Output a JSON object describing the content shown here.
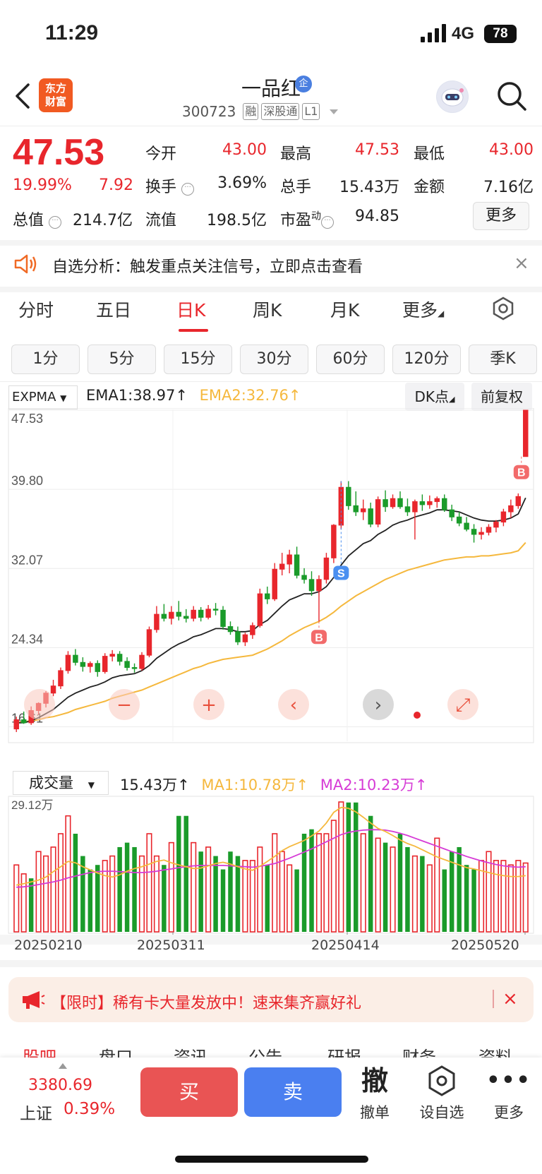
{
  "status": {
    "time": "11:29",
    "network": "4G",
    "battery": "78"
  },
  "header": {
    "logo_line1": "东方",
    "logo_line2": "财富",
    "stock_name": "一品红",
    "qi_badge": "企",
    "code": "300723",
    "tags": [
      "融",
      "深股通",
      "L1"
    ]
  },
  "quote": {
    "price": "47.53",
    "change_pct": "19.99%",
    "change": "7.92",
    "open_label": "今开",
    "open": "43.00",
    "high_label": "最高",
    "high": "47.53",
    "low_label": "最低",
    "low": "43.00",
    "turnover_label": "换手",
    "turnover": "3.69%",
    "volume_label": "总手",
    "volume": "15.43万",
    "amount_label": "金额",
    "amount": "7.16亿",
    "mktcap_label": "总值",
    "mktcap": "214.7亿",
    "float_label": "流值",
    "float": "198.5亿",
    "pe_label": "市盈",
    "pe_sup": "动",
    "pe": "94.85",
    "more": "更多"
  },
  "alert": {
    "text": "自选分析：触发重点关注信号，立即点击查看",
    "close": "×"
  },
  "tabs": [
    "分时",
    "五日",
    "日K",
    "周K",
    "月K",
    "更多"
  ],
  "active_tab": "日K",
  "periods": [
    "1分",
    "5分",
    "15分",
    "30分",
    "60分",
    "120分",
    "季K"
  ],
  "indicator": {
    "select": "EXPMA",
    "ema1": "EMA1:38.97",
    "ema2": "EMA2:32.76",
    "dk": "DK点",
    "adjust": "前复权",
    "ema1_color": "#222222",
    "ema2_color": "#f5b83d"
  },
  "price_axis": [
    "47.53",
    "39.80",
    "32.07",
    "24.34",
    "16.61"
  ],
  "volume_panel": {
    "select": "成交量",
    "value": "15.43万",
    "ma1": "MA1:10.78万",
    "ma2": "MA2:10.23万",
    "max": "29.12万",
    "ma1_color": "#f5b83d",
    "ma2_color": "#d63bd6"
  },
  "dates": [
    "20250210",
    "20250311",
    "20250414",
    "20250520"
  ],
  "chart_data": {
    "type": "candlestick",
    "ylim": [
      16.61,
      47.53
    ],
    "candles_ohlc": [
      [
        16.4,
        17.6,
        16.1,
        17.3
      ],
      [
        17.3,
        18.1,
        16.9,
        17.0
      ],
      [
        17.0,
        18.6,
        16.8,
        18.2
      ],
      [
        18.2,
        19.0,
        17.8,
        18.9
      ],
      [
        18.9,
        20.1,
        18.5,
        19.9
      ],
      [
        19.9,
        21.2,
        19.6,
        20.6
      ],
      [
        20.6,
        22.4,
        20.3,
        22.1
      ],
      [
        22.1,
        24.0,
        21.8,
        23.6
      ],
      [
        23.6,
        24.2,
        22.6,
        22.9
      ],
      [
        22.9,
        23.4,
        22.0,
        22.5
      ],
      [
        22.5,
        23.0,
        21.9,
        22.8
      ],
      [
        22.8,
        23.1,
        21.5,
        22.0
      ],
      [
        22.0,
        23.8,
        21.8,
        23.5
      ],
      [
        23.5,
        24.1,
        23.0,
        23.7
      ],
      [
        23.7,
        24.0,
        22.6,
        23.0
      ],
      [
        23.0,
        23.4,
        22.1,
        22.4
      ],
      [
        22.4,
        22.8,
        21.9,
        22.3
      ],
      [
        22.3,
        23.9,
        22.1,
        23.6
      ],
      [
        23.6,
        26.4,
        23.4,
        26.1
      ],
      [
        26.1,
        28.4,
        25.8,
        27.6
      ],
      [
        27.6,
        28.6,
        26.9,
        27.2
      ],
      [
        27.2,
        28.4,
        26.6,
        27.8
      ],
      [
        27.8,
        28.9,
        27.0,
        27.4
      ],
      [
        27.4,
        28.1,
        26.8,
        27.2
      ],
      [
        27.2,
        28.4,
        26.9,
        28.0
      ],
      [
        28.0,
        28.3,
        26.9,
        27.3
      ],
      [
        27.3,
        28.5,
        27.1,
        28.1
      ],
      [
        28.1,
        28.7,
        27.5,
        28.0
      ],
      [
        28.0,
        28.4,
        26.1,
        26.4
      ],
      [
        26.4,
        26.9,
        25.6,
        25.9
      ],
      [
        25.9,
        26.4,
        24.6,
        24.9
      ],
      [
        24.9,
        25.8,
        24.5,
        25.6
      ],
      [
        25.6,
        26.8,
        25.2,
        26.5
      ],
      [
        26.5,
        30.1,
        26.3,
        29.6
      ],
      [
        29.6,
        30.3,
        28.6,
        29.1
      ],
      [
        29.1,
        32.6,
        28.9,
        32.0
      ],
      [
        32.0,
        33.6,
        31.4,
        32.5
      ],
      [
        32.5,
        33.9,
        31.6,
        33.4
      ],
      [
        33.4,
        34.2,
        31.1,
        31.4
      ],
      [
        31.4,
        32.1,
        30.6,
        31.0
      ],
      [
        31.0,
        31.8,
        29.4,
        29.9
      ],
      [
        29.9,
        31.4,
        26.9,
        31.0
      ],
      [
        31.0,
        33.6,
        30.6,
        33.1
      ],
      [
        33.1,
        36.4,
        32.6,
        36.3
      ],
      [
        36.3,
        40.6,
        35.9,
        40.0
      ],
      [
        40.0,
        40.6,
        37.8,
        38.2
      ],
      [
        38.2,
        39.6,
        37.2,
        37.6
      ],
      [
        37.6,
        38.8,
        36.8,
        37.9
      ],
      [
        37.9,
        38.5,
        36.1,
        36.4
      ],
      [
        36.4,
        39.1,
        36.1,
        38.8
      ],
      [
        38.8,
        39.7,
        37.6,
        38.1
      ],
      [
        38.1,
        39.3,
        37.9,
        38.9
      ],
      [
        38.9,
        39.6,
        37.9,
        38.1
      ],
      [
        38.1,
        38.9,
        37.2,
        37.6
      ],
      [
        37.6,
        38.8,
        34.9,
        38.6
      ],
      [
        38.6,
        39.3,
        37.7,
        38.3
      ],
      [
        38.3,
        39.2,
        37.9,
        38.6
      ],
      [
        38.6,
        39.1,
        38.0,
        38.9
      ],
      [
        38.9,
        39.3,
        37.6,
        37.8
      ],
      [
        37.8,
        38.3,
        36.7,
        37.1
      ],
      [
        37.1,
        37.6,
        36.2,
        36.5
      ],
      [
        36.5,
        37.1,
        35.7,
        35.9
      ],
      [
        35.9,
        36.4,
        34.6,
        35.4
      ],
      [
        35.4,
        36.1,
        34.9,
        35.6
      ],
      [
        35.6,
        36.4,
        35.3,
        36.1
      ],
      [
        36.1,
        36.8,
        35.6,
        36.6
      ],
      [
        36.6,
        37.9,
        36.2,
        37.6
      ],
      [
        37.6,
        38.8,
        37.0,
        38.2
      ],
      [
        38.2,
        39.4,
        37.9,
        39.1
      ],
      [
        43.0,
        47.53,
        43.0,
        47.53
      ]
    ],
    "ema1": [
      17.0,
      17.0,
      17.2,
      17.5,
      17.9,
      18.3,
      18.9,
      19.5,
      19.9,
      20.2,
      20.5,
      20.7,
      21.0,
      21.4,
      21.6,
      21.7,
      21.8,
      22.1,
      22.6,
      23.3,
      23.8,
      24.3,
      24.7,
      25.0,
      25.4,
      25.6,
      25.9,
      26.2,
      26.2,
      26.1,
      25.9,
      25.9,
      26.0,
      26.6,
      27.0,
      27.7,
      28.4,
      29.0,
      29.3,
      29.6,
      29.6,
      29.8,
      30.3,
      31.2,
      32.4,
      33.3,
      33.9,
      34.5,
      34.8,
      35.4,
      35.8,
      36.3,
      36.6,
      36.8,
      37.1,
      37.3,
      37.5,
      37.8,
      37.8,
      37.7,
      37.6,
      37.3,
      37.0,
      36.8,
      36.7,
      36.7,
      36.8,
      37.0,
      37.4,
      38.97
    ],
    "ema2": [
      17.0,
      17.1,
      17.2,
      17.3,
      17.5,
      17.6,
      17.8,
      18.0,
      18.3,
      18.5,
      18.7,
      18.9,
      19.1,
      19.4,
      19.6,
      19.8,
      20.0,
      20.2,
      20.5,
      20.8,
      21.1,
      21.4,
      21.7,
      22.0,
      22.3,
      22.5,
      22.8,
      23.0,
      23.2,
      23.3,
      23.4,
      23.5,
      23.6,
      23.9,
      24.2,
      24.6,
      25.0,
      25.5,
      25.9,
      26.3,
      26.6,
      26.9,
      27.3,
      27.8,
      28.4,
      28.9,
      29.4,
      29.8,
      30.2,
      30.6,
      31.0,
      31.3,
      31.6,
      31.9,
      32.1,
      32.3,
      32.5,
      32.7,
      32.9,
      33.0,
      33.1,
      33.2,
      33.2,
      33.3,
      33.3,
      33.4,
      33.5,
      33.6,
      33.8,
      34.6
    ],
    "volume_wan": [
      15,
      13,
      12,
      18,
      17,
      19,
      22,
      26,
      22,
      17,
      14,
      15,
      16,
      17,
      19,
      20,
      19,
      17,
      22,
      17,
      15,
      20,
      26,
      26,
      20,
      18,
      19,
      17,
      14,
      18,
      17,
      16,
      16,
      19,
      15,
      22,
      18,
      15,
      14,
      22,
      23,
      22,
      22,
      25,
      29.12,
      29,
      29,
      22,
      26,
      21,
      20,
      19,
      22,
      19,
      17,
      17,
      15,
      21,
      14,
      18,
      19,
      15,
      14,
      16,
      18,
      16,
      16,
      15,
      16,
      15.43
    ],
    "volume_up": [
      true,
      true,
      false,
      true,
      true,
      true,
      true,
      true,
      false,
      false,
      false,
      false,
      true,
      true,
      false,
      false,
      false,
      true,
      true,
      true,
      false,
      true,
      false,
      false,
      true,
      false,
      true,
      false,
      false,
      false,
      false,
      true,
      true,
      true,
      false,
      true,
      true,
      true,
      false,
      false,
      false,
      true,
      true,
      true,
      true,
      false,
      false,
      true,
      false,
      true,
      false,
      true,
      false,
      false,
      true,
      false,
      true,
      true,
      false,
      false,
      false,
      false,
      false,
      true,
      true,
      true,
      true,
      true,
      true,
      true
    ],
    "ma1": [
      10.5,
      10.8,
      11.2,
      11.6,
      12.3,
      13.5,
      14.6,
      15.8,
      15.5,
      14.6,
      13.9,
      13.2,
      12.6,
      12.3,
      12.8,
      13.6,
      14.2,
      14.6,
      15.2,
      15.8,
      16.1,
      15.5,
      15.0,
      14.6,
      14.2,
      14.3,
      14.8,
      15.3,
      15.6,
      15.2,
      14.6,
      14.1,
      13.8,
      14.7,
      15.8,
      16.9,
      18.2,
      19.1,
      19.8,
      20.5,
      21.5,
      22.6,
      24.4,
      26.8,
      27.9,
      27.7,
      26.9,
      25.7,
      24.4,
      23.2,
      22.5,
      21.6,
      20.6,
      19.8,
      19.2,
      18.4,
      17.6,
      16.8,
      16.2,
      15.6,
      15.0,
      14.4,
      14.1,
      13.7,
      13.3,
      12.9,
      12.6,
      12.4,
      12.4,
      12.6
    ],
    "ma2": [
      10.0,
      10.1,
      10.3,
      10.6,
      10.9,
      11.2,
      11.6,
      12.1,
      12.5,
      12.9,
      13.3,
      13.5,
      13.6,
      13.6,
      13.5,
      13.4,
      13.3,
      13.3,
      13.4,
      13.6,
      13.9,
      14.1,
      14.4,
      14.6,
      14.8,
      14.9,
      14.9,
      14.9,
      14.9,
      14.8,
      14.7,
      14.6,
      14.5,
      14.7,
      15.0,
      15.3,
      15.9,
      16.5,
      17.2,
      17.9,
      18.6,
      19.4,
      20.2,
      21.0,
      21.8,
      22.3,
      22.6,
      22.8,
      22.9,
      22.9,
      22.8,
      22.5,
      22.1,
      21.6,
      21.0,
      20.4,
      19.8,
      19.2,
      18.6,
      18.0,
      17.5,
      16.9,
      16.4,
      15.9,
      15.5,
      15.1,
      14.8,
      14.6,
      14.5,
      14.6
    ],
    "signals": [
      {
        "label": "B",
        "index": 41
      },
      {
        "label": "S",
        "index": 44
      },
      {
        "label": "B",
        "index": 69
      }
    ]
  },
  "promo": {
    "text": "【限时】稀有卡大量发放中！速来集齐赢好礼",
    "close": "×"
  },
  "bottom_tabs": [
    "股吧",
    "盘口",
    "资讯",
    "公告",
    "研报",
    "财务",
    "资料"
  ],
  "index": {
    "value": "3380.69",
    "name": "上证",
    "pct": "0.39%"
  },
  "actions": {
    "buy": "买",
    "sell": "卖",
    "cancel_icon": "撤",
    "cancel": "撤单",
    "watch": "设自选",
    "more": "更多"
  }
}
